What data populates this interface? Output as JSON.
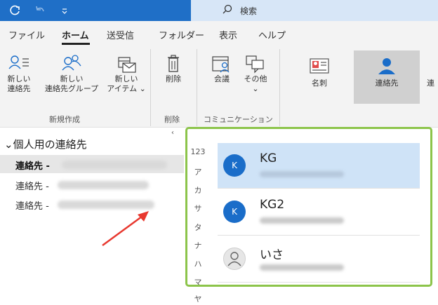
{
  "titlebar": {
    "search_label": "検索",
    "icons": [
      "sync-icon",
      "undo-icon",
      "quick-access-dropdown-icon",
      "search-icon"
    ]
  },
  "menu": {
    "tabs": [
      {
        "label": "ファイル",
        "active": false
      },
      {
        "label": "ホーム",
        "active": true
      },
      {
        "label": "送受信",
        "active": false
      },
      {
        "label": "フォルダー",
        "active": false
      },
      {
        "label": "表示",
        "active": false
      },
      {
        "label": "ヘルプ",
        "active": false
      }
    ]
  },
  "ribbon": {
    "new_contact": {
      "line1": "新しい",
      "line2": "連絡先"
    },
    "new_group": {
      "line1": "新しい",
      "line2": "連絡先グループ"
    },
    "new_items": {
      "line1": "新しい",
      "line2": "アイテム ⌄"
    },
    "delete": "削除",
    "meeting": "会議",
    "more": {
      "line1": "その他",
      "line2": "⌄"
    },
    "groups": {
      "new": "新規作成",
      "delete": "削除",
      "communicate": "コミュニケーション"
    },
    "views": {
      "business_card": "名刺",
      "contact": "連絡先",
      "partial": "連"
    }
  },
  "leftpane": {
    "collapse_glyph": "‹",
    "header": "⌄個人用の連絡先",
    "folders": [
      {
        "label": "連絡先 -",
        "active": true
      },
      {
        "label": "連絡先 -",
        "active": false
      },
      {
        "label": "連絡先 -",
        "active": false
      }
    ]
  },
  "rightpane": {
    "index": [
      "123",
      "ア",
      "カ",
      "サ",
      "タ",
      "ナ",
      "ハ",
      "マ",
      "ヤ"
    ],
    "contacts": [
      {
        "initial": "K",
        "name": "KG",
        "selected": true
      },
      {
        "initial": "K",
        "name": "KG2",
        "selected": false
      },
      {
        "initial": "",
        "name": "いさ",
        "selected": false
      }
    ]
  },
  "colors": {
    "title_blue": "#1f6fc7",
    "accent_blue": "#1a6dc9",
    "selected_row": "#cfe3f7",
    "highlight_green": "#8cc44a",
    "arrow_red": "#e8382f"
  }
}
